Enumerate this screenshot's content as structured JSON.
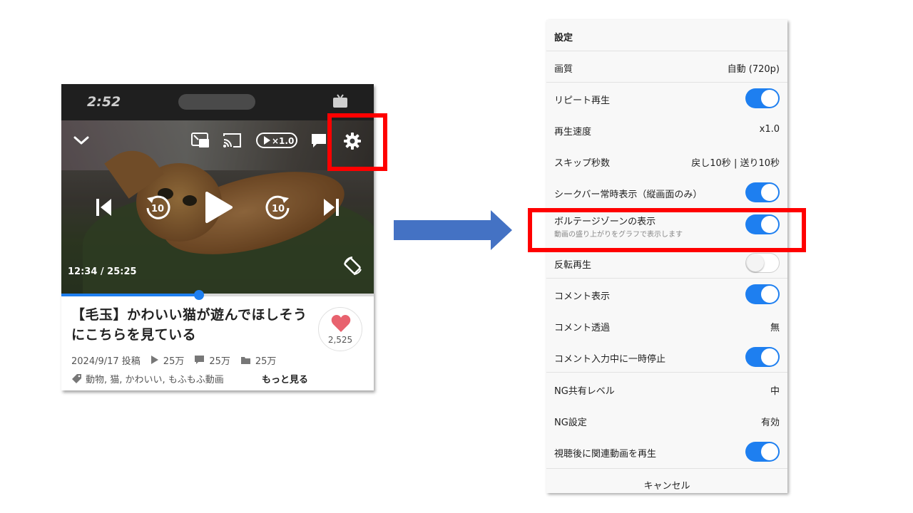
{
  "phone": {
    "status_time": "2:52",
    "status_icons": [
      "tv-icon"
    ],
    "player_controls": [
      "chevron-down-icon",
      "picture-in-picture-icon",
      "cast-icon",
      "playback-speed-icon",
      "comment-icon",
      "gear-icon",
      "skip-previous-icon",
      "replay-10-icon",
      "play-icon",
      "forward-10-icon",
      "skip-next-icon",
      "rotate-icon"
    ],
    "speed_badge": "×1.0",
    "replay_seconds": "10",
    "forward_seconds": "10",
    "time_display": "12:34 / 25:25",
    "progress": 0.44,
    "title": "【毛玉】かわいい猫が遊んでほしそうにこちらを見ている",
    "like_count": "2,525",
    "posted": "2024/9/17 投稿",
    "views": "25万",
    "comments": "25万",
    "mylists": "25万",
    "tags": "動物, 猫, かわいい, もふもふ動画",
    "more_label": "もっと見る"
  },
  "settings": {
    "title": "設定",
    "rows": [
      {
        "label": "画質",
        "value": "自動 (720p)"
      },
      {
        "label": "リピート再生",
        "toggle": true
      },
      {
        "label": "再生速度",
        "value": "x1.0"
      },
      {
        "label": "スキップ秒数",
        "value": "戻し10秒 | 送り10秒"
      },
      {
        "label": "シークバー常時表示（縦画面のみ）",
        "toggle": true
      },
      {
        "label": "ボルテージゾーンの表示",
        "sublabel": "動画の盛り上がりをグラフで表示します",
        "toggle": true
      },
      {
        "label": "反転再生",
        "toggle": false
      },
      {
        "label": "コメント表示",
        "toggle": true
      },
      {
        "label": "コメント透過",
        "value": "無"
      },
      {
        "label": "コメント入力中に一時停止",
        "toggle": true
      },
      {
        "label": "NG共有レベル",
        "value": "中"
      },
      {
        "label": "NG設定",
        "value": "有効"
      },
      {
        "label": "視聴後に関連動画を再生",
        "toggle": true
      }
    ],
    "cancel_label": "キャンセル"
  },
  "colors": {
    "accent_blue": "#1E7FF0",
    "highlight_red": "#FF0000",
    "arrow_blue": "#4472C4",
    "like_heart": "#E8626E"
  }
}
